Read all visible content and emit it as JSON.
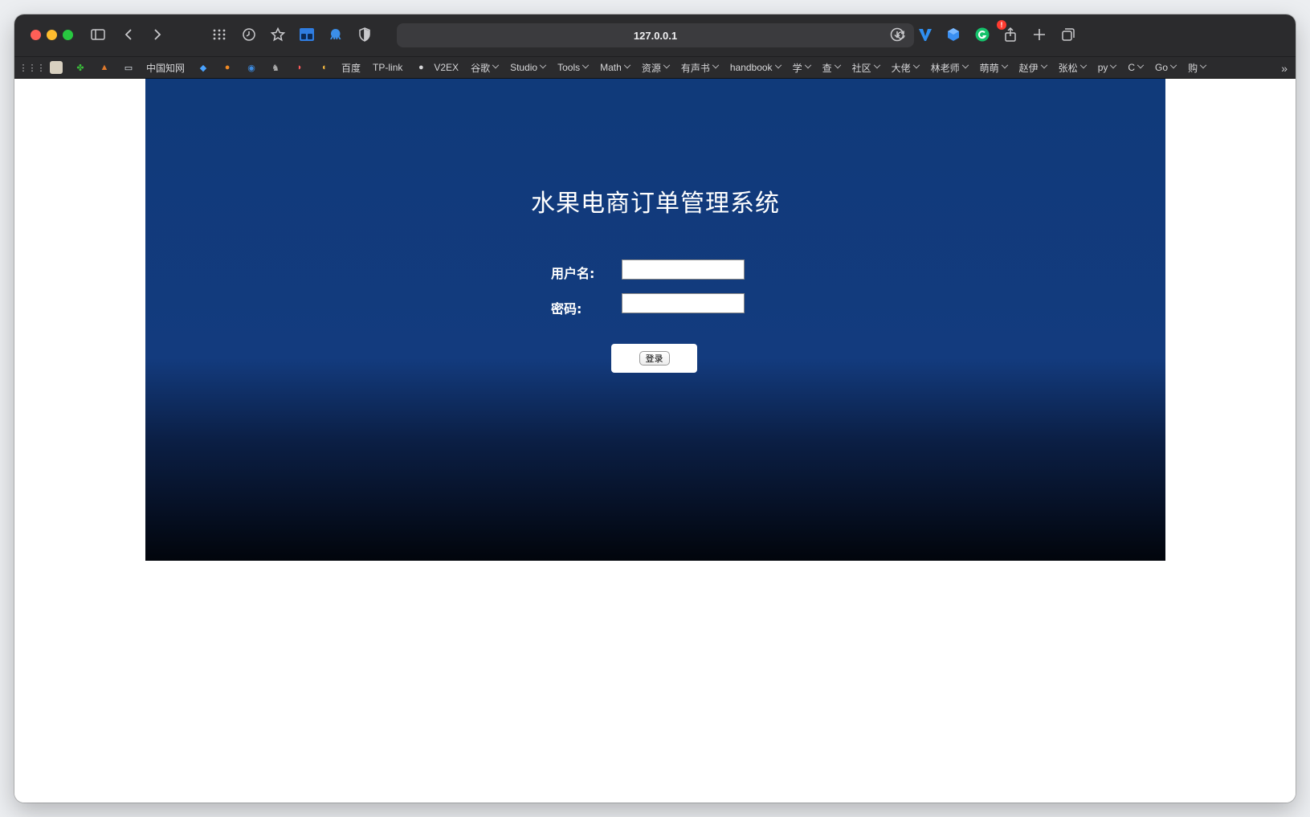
{
  "browser": {
    "url": "127.0.0.1",
    "bookmarks": [
      {
        "label": "中国知网",
        "dropdown": false
      },
      {
        "label": "百度",
        "dropdown": false
      },
      {
        "label": "TP-link",
        "dropdown": false
      },
      {
        "label": "V2EX",
        "dropdown": false
      },
      {
        "label": "谷歌",
        "dropdown": true
      },
      {
        "label": "Studio",
        "dropdown": true
      },
      {
        "label": "Tools",
        "dropdown": true
      },
      {
        "label": "Math",
        "dropdown": true
      },
      {
        "label": "资源",
        "dropdown": true
      },
      {
        "label": "有声书",
        "dropdown": true
      },
      {
        "label": "handbook",
        "dropdown": true
      },
      {
        "label": "学",
        "dropdown": true
      },
      {
        "label": "查",
        "dropdown": true
      },
      {
        "label": "社区",
        "dropdown": true
      },
      {
        "label": "大佬",
        "dropdown": true
      },
      {
        "label": "林老师",
        "dropdown": true
      },
      {
        "label": "萌萌",
        "dropdown": true
      },
      {
        "label": "赵伊",
        "dropdown": true
      },
      {
        "label": "张松",
        "dropdown": true
      },
      {
        "label": "py",
        "dropdown": true
      },
      {
        "label": "C",
        "dropdown": true
      },
      {
        "label": "Go",
        "dropdown": true
      },
      {
        "label": "购",
        "dropdown": true
      }
    ],
    "extension_badge": "!"
  },
  "login": {
    "title": "水果电商订单管理系统",
    "username_label": "用户名:",
    "password_label": "密码:",
    "username_value": "",
    "password_value": "",
    "submit_label": "登录"
  },
  "colors": {
    "gradient_top": "#103a7a",
    "gradient_bottom": "#02050c"
  }
}
